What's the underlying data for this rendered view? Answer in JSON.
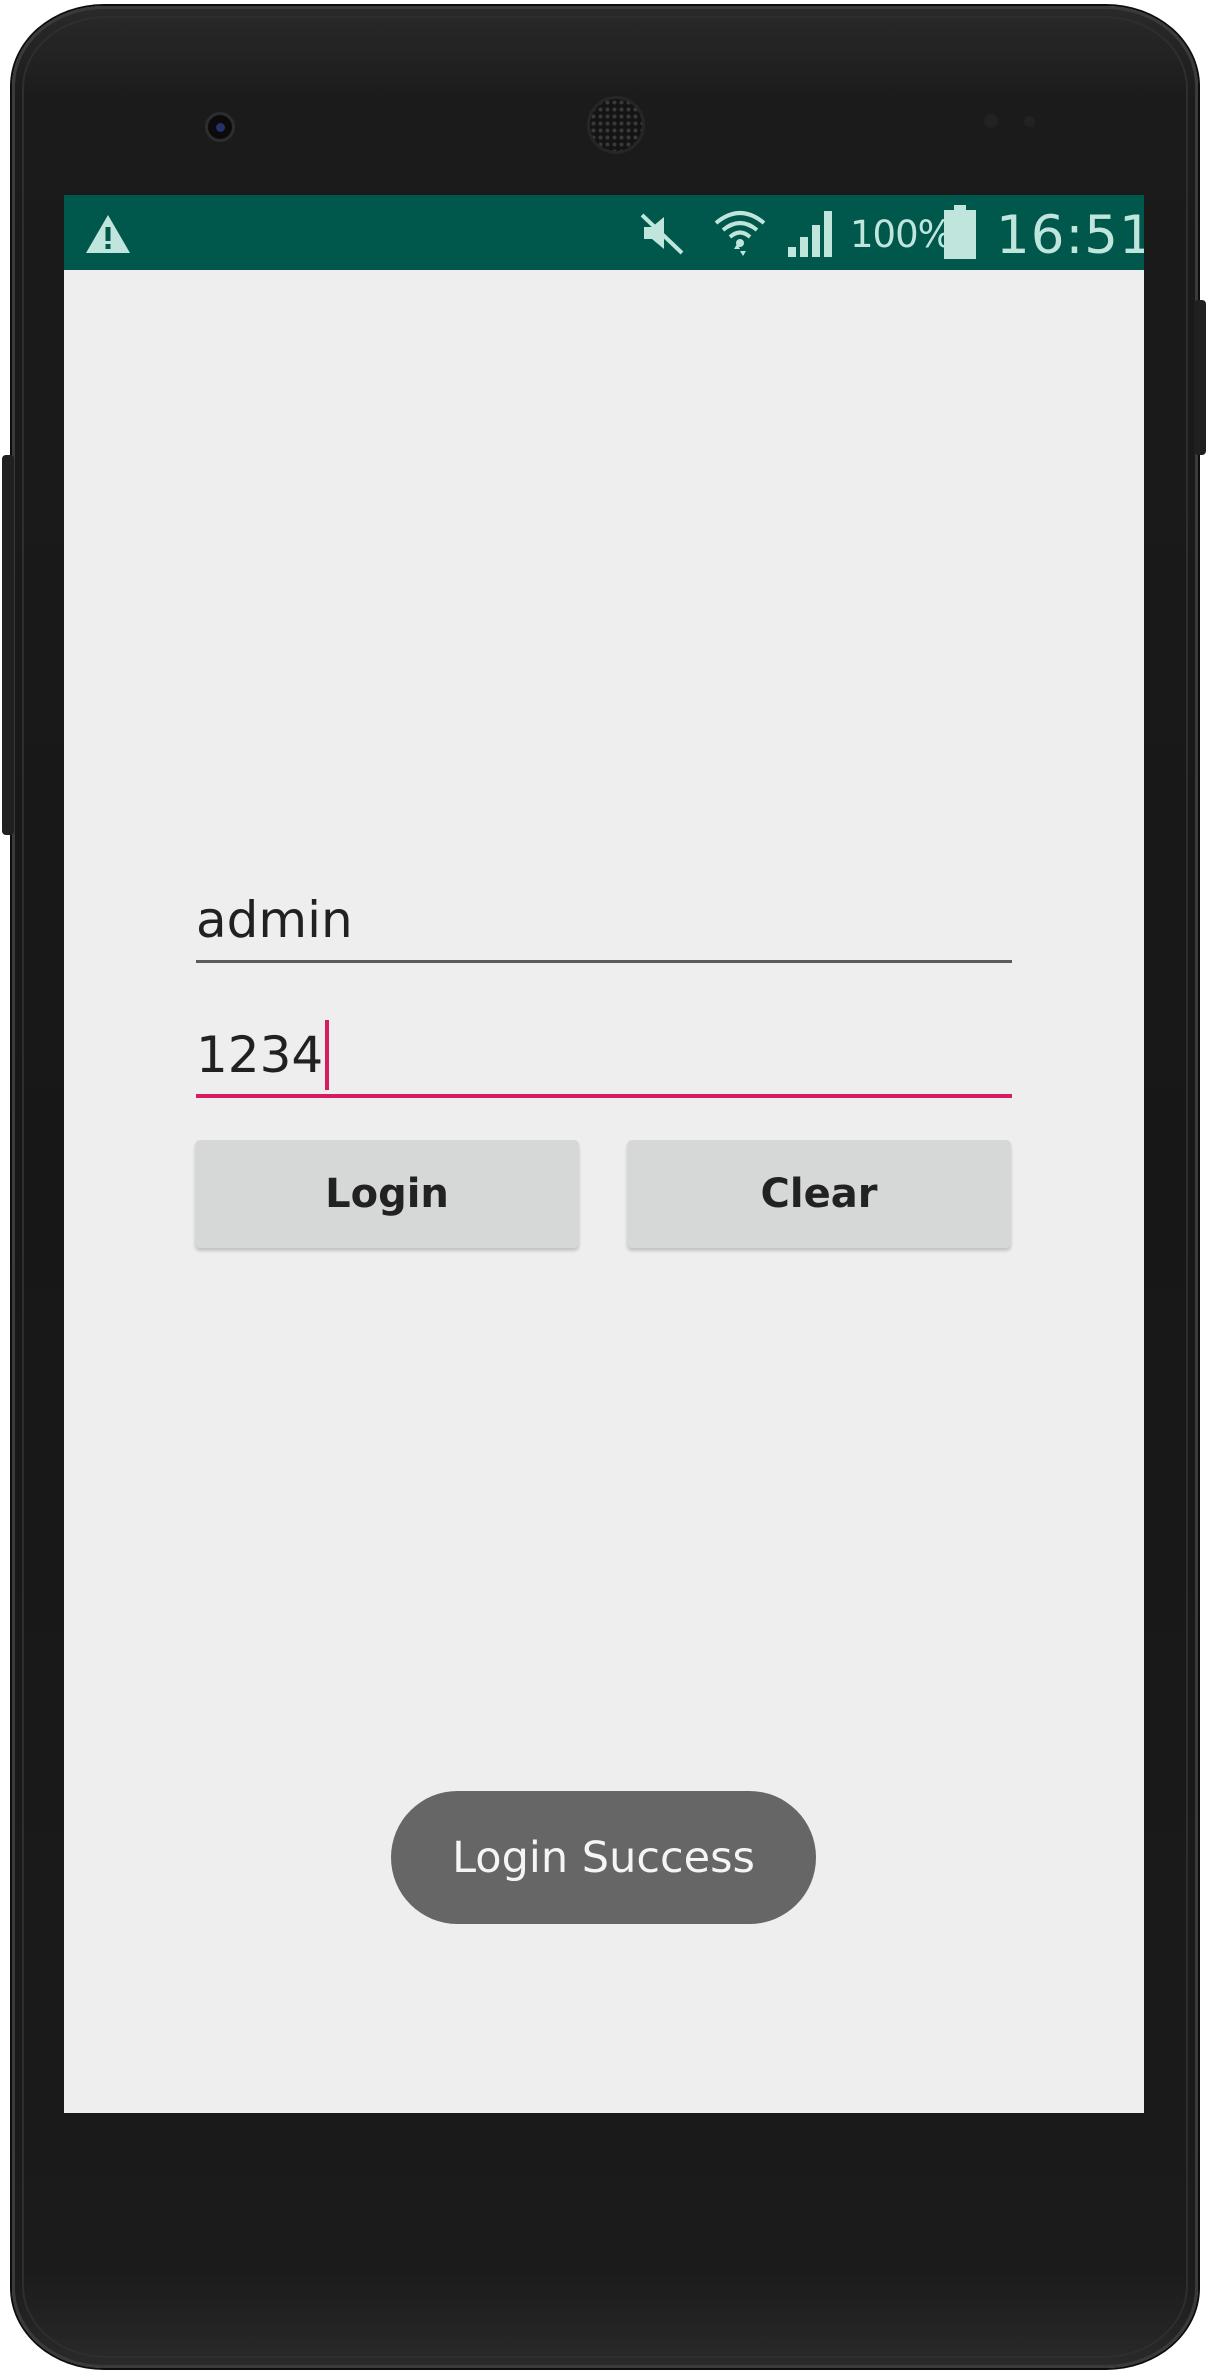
{
  "status_bar": {
    "battery_percent": "100%",
    "time": "16:51",
    "icons": [
      "warning-icon",
      "mute-icon",
      "wifi-icon",
      "signal-icon",
      "battery-icon"
    ],
    "background_color": "#00574b"
  },
  "login_form": {
    "username_value": "admin",
    "password_value": "1234",
    "login_label": "Login",
    "clear_label": "Clear",
    "accent_color": "#d81b60"
  },
  "toast": {
    "message": "Login Success"
  }
}
